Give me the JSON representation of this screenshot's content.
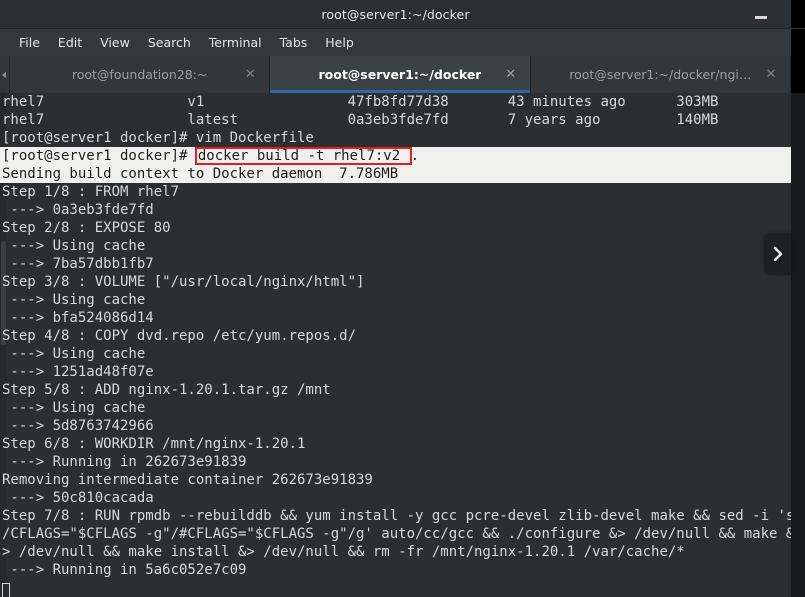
{
  "window": {
    "title": "root@server1:~/docker",
    "minimize_label": "–"
  },
  "menubar": {
    "items": [
      {
        "label": "File"
      },
      {
        "label": "Edit"
      },
      {
        "label": "View"
      },
      {
        "label": "Search"
      },
      {
        "label": "Terminal"
      },
      {
        "label": "Tabs"
      },
      {
        "label": "Help"
      }
    ]
  },
  "tabs": {
    "close_glyph": "✕",
    "items": [
      {
        "label": "root@foundation28:~",
        "active": false
      },
      {
        "label": "root@server1:~/docker",
        "active": true
      },
      {
        "label": "root@server1:~/docker/ngi…",
        "active": false
      }
    ]
  },
  "overlay": {
    "next_arrow_label": "›"
  },
  "terminal": {
    "lines": [
      {
        "text": "rhel7                 v1                 47fb8fd77d38       43 minutes ago      303MB",
        "highlight": false
      },
      {
        "text": "rhel7                 latest             0a3eb3fde7fd       7 years ago         140MB",
        "highlight": false
      },
      {
        "text": "[root@server1 docker]# vim Dockerfile",
        "highlight": false
      },
      {
        "text": "[root@server1 docker]# docker build -t rhel7:v2 .",
        "highlight": true,
        "boxed": {
          "prefix": "[root@server1 docker]# ",
          "boxed_text": "docker build -t rhel7:v2 ",
          "suffix": "."
        }
      },
      {
        "text": "Sending build context to Docker daemon  7.786MB",
        "highlight": true
      },
      {
        "text": "Step 1/8 : FROM rhel7",
        "highlight": false
      },
      {
        "text": " ---> 0a3eb3fde7fd",
        "highlight": false
      },
      {
        "text": "Step 2/8 : EXPOSE 80",
        "highlight": false
      },
      {
        "text": " ---> Using cache",
        "highlight": false
      },
      {
        "text": " ---> 7ba57dbb1fb7",
        "highlight": false
      },
      {
        "text": "Step 3/8 : VOLUME [\"/usr/local/nginx/html\"]",
        "highlight": false
      },
      {
        "text": " ---> Using cache",
        "highlight": false
      },
      {
        "text": " ---> bfa524086d14",
        "highlight": false
      },
      {
        "text": "Step 4/8 : COPY dvd.repo /etc/yum.repos.d/",
        "highlight": false
      },
      {
        "text": " ---> Using cache",
        "highlight": false
      },
      {
        "text": " ---> 1251ad48f07e",
        "highlight": false
      },
      {
        "text": "Step 5/8 : ADD nginx-1.20.1.tar.gz /mnt",
        "highlight": false
      },
      {
        "text": " ---> Using cache",
        "highlight": false
      },
      {
        "text": " ---> 5d8763742966",
        "highlight": false
      },
      {
        "text": "Step 6/8 : WORKDIR /mnt/nginx-1.20.1",
        "highlight": false
      },
      {
        "text": " ---> Running in 262673e91839",
        "highlight": false
      },
      {
        "text": "Removing intermediate container 262673e91839",
        "highlight": false
      },
      {
        "text": " ---> 50c810cacada",
        "highlight": false
      },
      {
        "text": "Step 7/8 : RUN rpmdb --rebuilddb && yum install -y gcc pcre-devel zlib-devel make && sed -i 's",
        "highlight": false
      },
      {
        "text": "/CFLAGS=\"$CFLAGS -g\"/#CFLAGS=\"$CFLAGS -g\"/g' auto/cc/gcc && ./configure &> /dev/null && make &",
        "highlight": false
      },
      {
        "text": "> /dev/null && make install &> /dev/null && rm -fr /mnt/nginx-1.20.1 /var/cache/*",
        "highlight": false
      },
      {
        "text": " ---> Running in 5a6c052e7c09",
        "highlight": false
      },
      {
        "text": "",
        "highlight": false,
        "cursor": true
      }
    ]
  },
  "colors": {
    "terminal_bg": "#2b2f31",
    "terminal_fg": "#d8d8d8",
    "highlight_bg": "#f0f0ee",
    "annotation_red": "#e02020",
    "tab_accent": "#3465a4"
  }
}
